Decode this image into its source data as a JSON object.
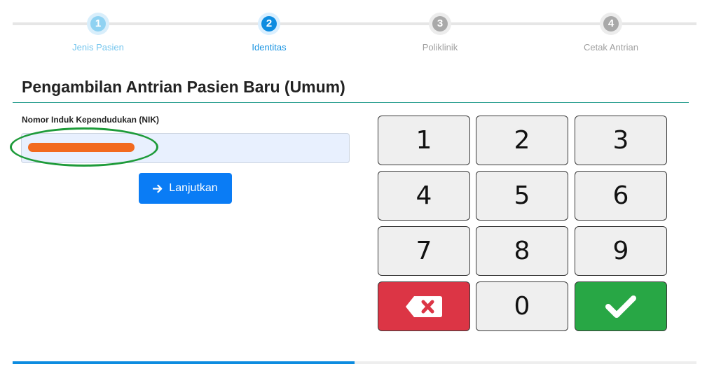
{
  "steps": [
    {
      "number": "1",
      "label": "Jenis Pasien",
      "state": "done"
    },
    {
      "number": "2",
      "label": "Identitas",
      "state": "active"
    },
    {
      "number": "3",
      "label": "Poliklinik",
      "state": "todo"
    },
    {
      "number": "4",
      "label": "Cetak Antrian",
      "state": "todo"
    }
  ],
  "page": {
    "title": "Pengambilan Antrian Pasien Baru (Umum)"
  },
  "form": {
    "nik_label": "Nomor Induk Kependudukan (NIK)",
    "nik_value": "",
    "submit_label": "Lanjutkan",
    "submit_icon": "arrow-right-icon"
  },
  "keypad": {
    "k1": "1",
    "k2": "2",
    "k3": "3",
    "k4": "4",
    "k5": "5",
    "k6": "6",
    "k7": "7",
    "k8": "8",
    "k9": "9",
    "k0": "0",
    "delete_icon": "backspace-icon",
    "confirm_icon": "check-icon"
  },
  "progress": {
    "fraction": 0.5
  },
  "colors": {
    "primary": "#0a7cf5",
    "danger": "#dc3545",
    "success": "#28a745",
    "highlight_annotation": "#1e9b3a",
    "redaction": "#f26a1f"
  }
}
